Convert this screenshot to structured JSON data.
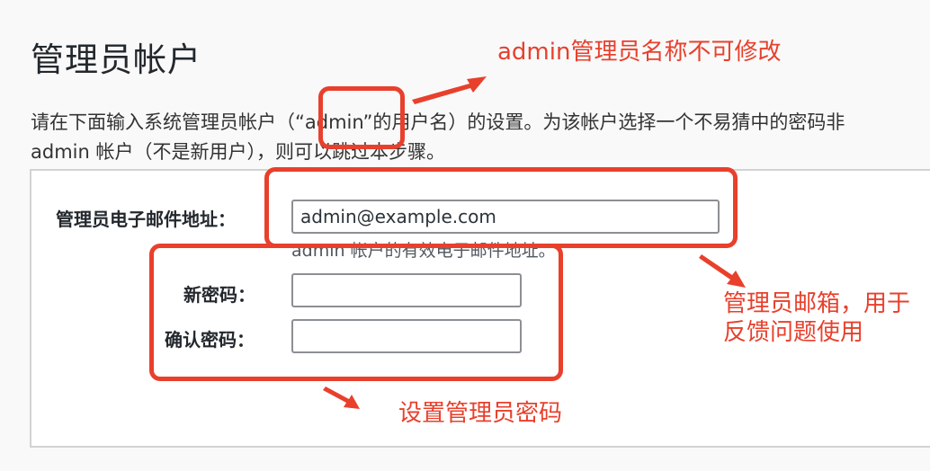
{
  "page": {
    "title": "管理员帐户",
    "description_line1": "请在下面输入系统管理员帐户（“admin”的用户名）的设置。为该帐户选择一个不易猜中的密码非",
    "description_line2": "admin 帐户（不是新用户），则可以跳过本步骤。"
  },
  "form": {
    "email_label": "管理员电子邮件地址：",
    "email_value": "admin@example.com",
    "email_hint": "admin 帐户的有效电子邮件地址。",
    "new_password_label": "新密码：",
    "new_password_value": "",
    "confirm_password_label": "确认密码：",
    "confirm_password_value": ""
  },
  "annotations": {
    "admin_note": "admin管理员名称不可修改",
    "email_note_line1": "管理员邮箱，用于",
    "email_note_line2": "反馈问题使用",
    "password_note": "设置管理员密码",
    "color": "#e8402c"
  }
}
